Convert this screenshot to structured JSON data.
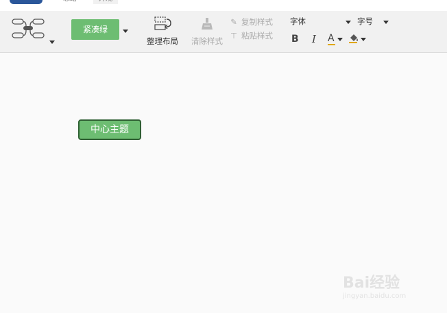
{
  "tabs": [
    {
      "label": "思路"
    },
    {
      "label": "外观"
    }
  ],
  "toolbar": {
    "structure_icon": "mindmap-structure-icon",
    "theme_label": "紧凑绿",
    "layout_label": "整理布局",
    "clear_style_label": "清除样式",
    "copy_style_label": "复制样式",
    "paste_style_label": "粘贴样式",
    "font_value": "字体",
    "size_value": "字号",
    "bold_label": "B",
    "italic_label": "I",
    "font_color_label": "A"
  },
  "canvas": {
    "central_topic": "中心主题"
  },
  "watermark": {
    "brand": "Bai经验",
    "url": "jingyan.baidu.com"
  },
  "colors": {
    "accent_green": "#6dbd72",
    "topic_border": "#2f5f33",
    "toolbar_bg": "#f1f1f1",
    "canvas_bg": "#fafafa",
    "logo_blue": "#2b579a",
    "font_color_bar": "#e0a800"
  }
}
